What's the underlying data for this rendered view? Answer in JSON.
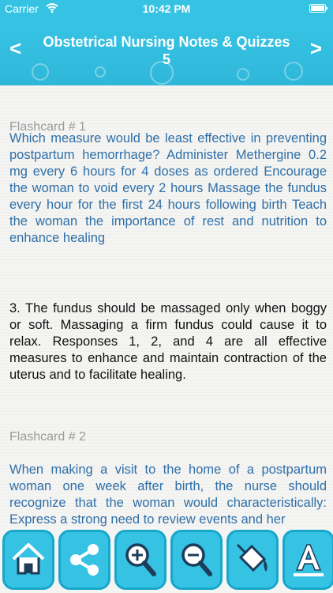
{
  "status": {
    "carrier": "Carrier",
    "time": "10:42 PM",
    "wifi_icon": "wifi-icon",
    "battery_icon": "battery-icon"
  },
  "header": {
    "title": "Obstetrical Nursing Notes & Quizzes 5",
    "prev_arrow": "<",
    "next_arrow": ">"
  },
  "cards": [
    {
      "heading": "Flashcard # 1",
      "question": "Which measure would be least effective in preventing postpartum hemorrhage? Administer Methergine 0.2 mg every 6 hours for 4 doses as ordered Encourage the woman to void every 2 hours Massage the fundus every hour for the first 24 hours following birth Teach the woman the importance of rest and nutrition to enhance healing",
      "answer": "3. The fundus should be massaged only when boggy or soft. Massaging a firm fundus could cause it to relax. Responses 1, 2, and 4 are all effective measures to enhance and maintain contraction of the uterus and to facilitate healing."
    },
    {
      "heading": "Flashcard # 2",
      "question": "When making a visit to the home of a postpartum woman one week after birth, the nurse should recognize that the woman would characteristically: Express a strong need to review events and her"
    }
  ],
  "toolbar": {
    "buttons": [
      "home-icon",
      "share-icon",
      "zoom-in-icon",
      "zoom-out-icon",
      "paint-bucket-icon",
      "font-style-icon"
    ]
  },
  "colors": {
    "accent": "#36c3e3",
    "button_border": "#18a7cc",
    "question_text": "#2f6fa8",
    "heading_text": "#9a9a9a"
  }
}
